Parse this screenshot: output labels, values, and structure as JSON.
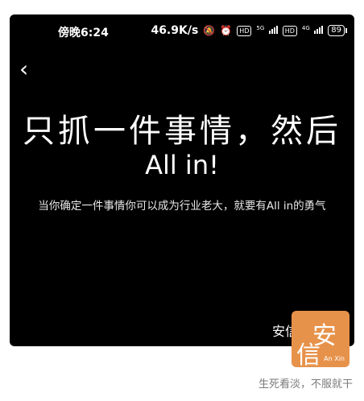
{
  "status_bar": {
    "time": "傍晚6:24",
    "speed": "46.9K/s",
    "hd1": "HD",
    "net1": "5G",
    "hd2": "HD",
    "net2": "4G",
    "battery": "89"
  },
  "screen": {
    "headline": "只抓一件事情，然后",
    "allin": "All in!",
    "subline": "当你确定一件事情你可以成为行业老大，就要有All in的勇气",
    "brand": "安信"
  },
  "logo": {
    "char_big": "安",
    "char_small": "信",
    "latin": "An Xin"
  },
  "caption": "生死看淡，不服就干",
  "icons": {
    "back": "chevron-left-icon",
    "mute": "notification-off-icon",
    "alarm": "alarm-icon"
  }
}
